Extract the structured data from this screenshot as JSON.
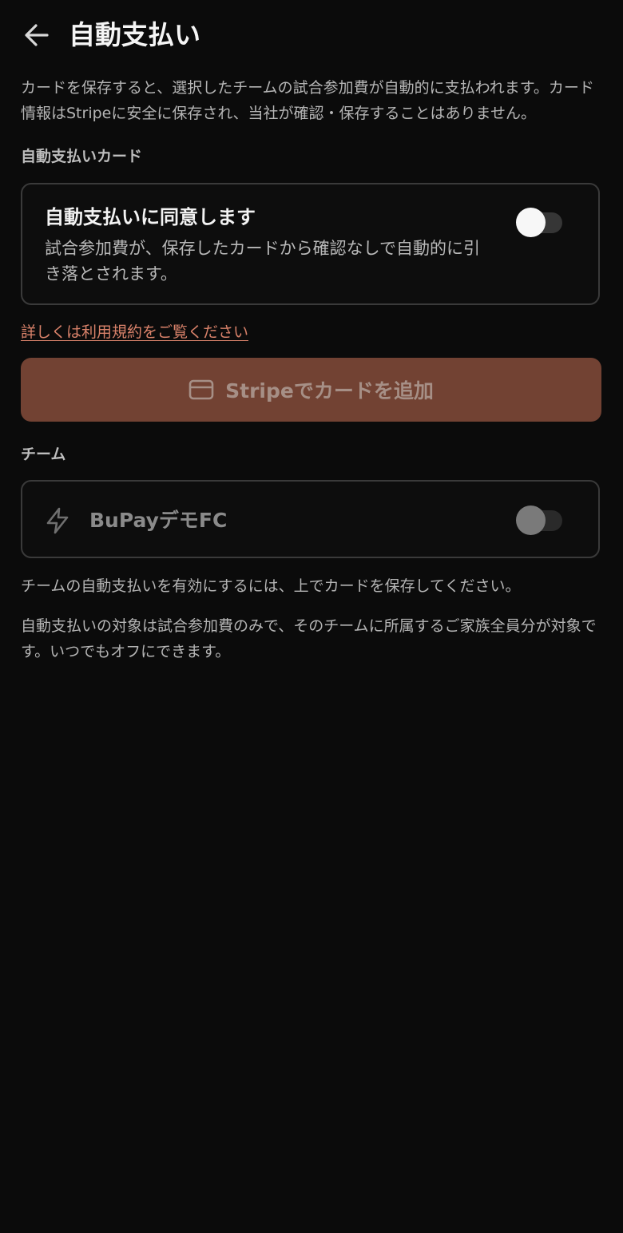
{
  "header": {
    "title": "自動支払い",
    "back_icon": "arrow-left-icon"
  },
  "intro_text": "カードを保存すると、選択したチームの試合参加費が自動的に支払われます。カード情報はStripeに安全に保存され、当社が確認・保存することはありません。",
  "card_section": {
    "label": "自動支払いカード",
    "consent_title": "自動支払いに同意します",
    "consent_description": "試合参加費が、保存したカードから確認なしで自動的に引き落とされます。",
    "consent_enabled": false
  },
  "terms_link": "詳しくは利用規約をご覧ください",
  "stripe_button": {
    "label": "Stripeでカードを追加",
    "icon": "credit-card-icon"
  },
  "team_section": {
    "label": "チーム",
    "teams": [
      {
        "name": "BuPayデモFC",
        "icon": "lightning-icon",
        "enabled": false,
        "disabled": true
      }
    ]
  },
  "notes": {
    "enable_hint": "チームの自動支払いを有効にするには、上でカードを保存してください。",
    "scope_info": "自動支払いの対象は試合参加費のみで、そのチームに所属するご家族全員分が対象です。いつでもオフにできます。"
  },
  "colors": {
    "background": "#0b0b0b",
    "accent_button": "#724233",
    "link": "#d9826a"
  }
}
